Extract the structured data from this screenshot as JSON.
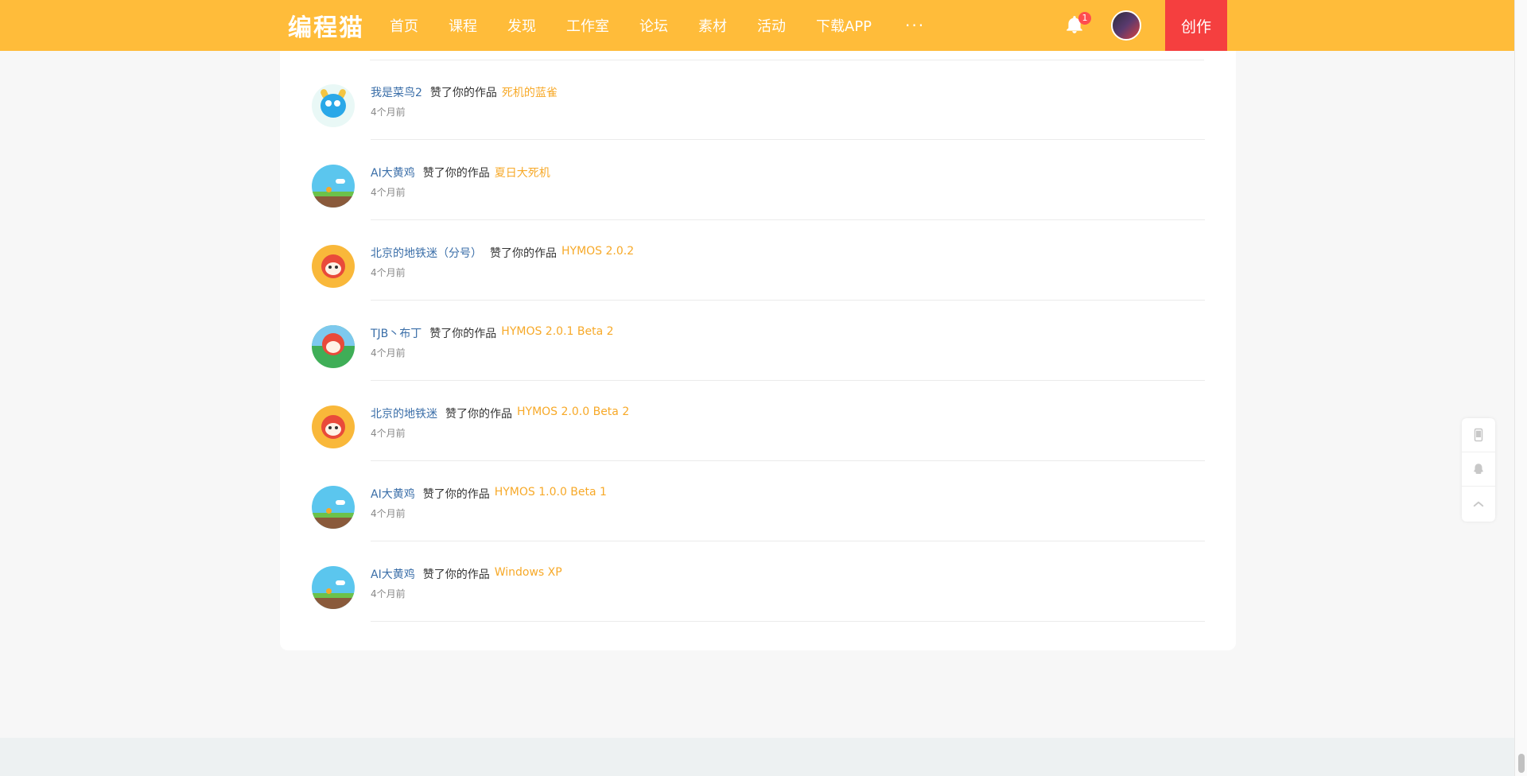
{
  "header": {
    "logo": "编程猫",
    "nav": [
      "首页",
      "课程",
      "发现",
      "工作室",
      "论坛",
      "素材",
      "活动",
      "下载APP"
    ],
    "more": "···",
    "notification_count": "1",
    "create_label": "创作"
  },
  "feed": {
    "items": [
      {
        "user": "我是菜鸟2",
        "action": "赞了你的作品",
        "work": "死机的蓝雀",
        "time": "4个月前",
        "avatar": "blue-bird"
      },
      {
        "user": "AI大黄鸡",
        "action": "赞了你的作品",
        "work": "夏日大死机",
        "time": "4个月前",
        "avatar": "scene"
      },
      {
        "user": "北京的地铁迷（分号）",
        "action": "赞了你的作品",
        "work": "HYMOS 2.0.2",
        "time": "4个月前",
        "avatar": "fox"
      },
      {
        "user": "TJB丶布丁",
        "action": "赞了你的作品",
        "work": "HYMOS 2.0.1 Beta 2",
        "time": "4个月前",
        "avatar": "fox-green"
      },
      {
        "user": "北京的地铁迷",
        "action": "赞了你的作品",
        "work": "HYMOS 2.0.0 Beta 2",
        "time": "4个月前",
        "avatar": "fox"
      },
      {
        "user": "AI大黄鸡",
        "action": "赞了你的作品",
        "work": "HYMOS 1.0.0 Beta 1",
        "time": "4个月前",
        "avatar": "scene"
      },
      {
        "user": "AI大黄鸡",
        "action": "赞了你的作品",
        "work": "Windows XP",
        "time": "4个月前",
        "avatar": "scene"
      }
    ]
  },
  "float_bar": {
    "icons": [
      "phone-icon",
      "qq-icon",
      "back-to-top-icon"
    ]
  },
  "colors": {
    "header_bg": "#ffbc3a",
    "create_bg": "#f53f3f",
    "user_link": "#3a6ea8",
    "work_link": "#f7a928"
  }
}
